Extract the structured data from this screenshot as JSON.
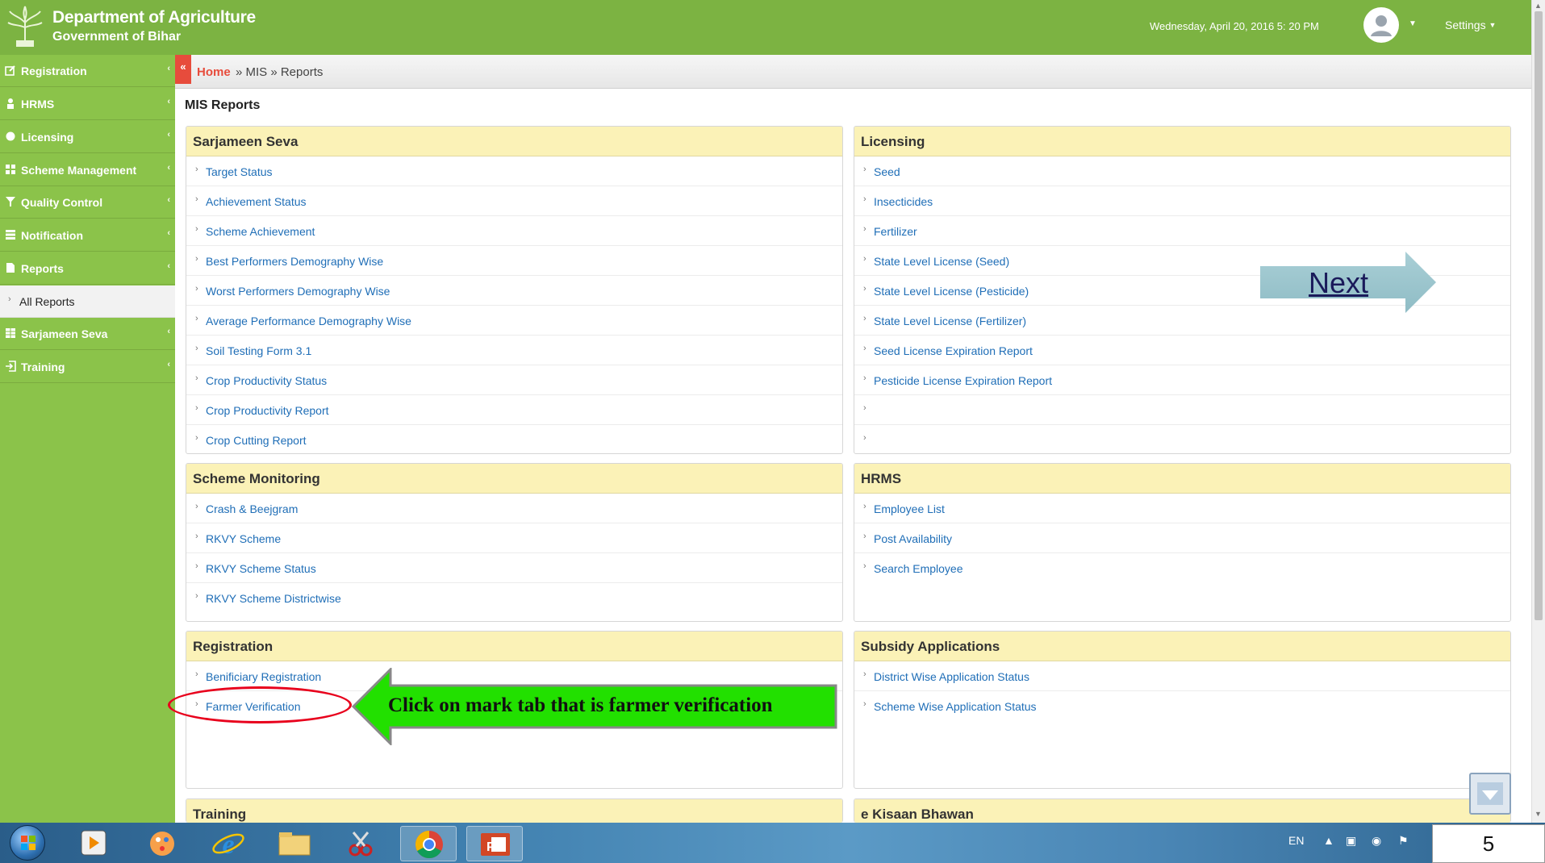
{
  "header": {
    "title": "Department of Agriculture",
    "subtitle": "Government of Bihar",
    "datetime": "Wednesday, April 20, 2016  5: 20 PM",
    "settings_label": "Settings"
  },
  "sidebar": {
    "items": [
      {
        "label": "Registration",
        "icon": "edit-icon",
        "chevron": "‹"
      },
      {
        "label": "HRMS",
        "icon": "user-icon",
        "chevron": "‹"
      },
      {
        "label": "Licensing",
        "icon": "circle-icon",
        "chevron": "‹"
      },
      {
        "label": "Scheme Management",
        "icon": "grid-icon",
        "chevron": "‹"
      },
      {
        "label": "Quality Control",
        "icon": "filter-icon",
        "chevron": "‹"
      },
      {
        "label": "Notification",
        "icon": "list-icon",
        "chevron": "‹"
      },
      {
        "label": "Reports",
        "icon": "document-icon",
        "chevron": "‹"
      },
      {
        "label": "Sarjameen Seva",
        "icon": "table-icon",
        "chevron": "‹"
      },
      {
        "label": "Training",
        "icon": "signin-icon",
        "chevron": "‹"
      }
    ],
    "sub_item": "All Reports"
  },
  "breadcrumb": {
    "toggle": "«",
    "home": "Home",
    "rest": "» MIS » Reports"
  },
  "page_title": "MIS Reports",
  "panels": {
    "sarjameen": {
      "title": "Sarjameen Seva",
      "rows": [
        "Target Status",
        "Achievement Status",
        "Scheme Achievement",
        "Best Performers Demography Wise",
        "Worst Performers Demography Wise",
        "Average Performance Demography Wise",
        "Soil Testing Form 3.1",
        "Crop Productivity Status",
        "Crop Productivity Report",
        "Crop Cutting Report"
      ]
    },
    "licensing": {
      "title": "Licensing",
      "rows": [
        "Seed",
        "Insecticides",
        "Fertilizer",
        "State Level License (Seed)",
        "State Level License (Pesticide)",
        "State Level License (Fertilizer)",
        "Seed License Expiration Report",
        "Pesticide License Expiration Report",
        "",
        ""
      ]
    },
    "scheme_monitoring": {
      "title": "Scheme Monitoring",
      "rows": [
        "Crash & Beejgram",
        "RKVY Scheme",
        "RKVY Scheme Status",
        "RKVY Scheme Districtwise"
      ]
    },
    "hrms": {
      "title": "HRMS",
      "rows": [
        "Employee List",
        "Post Availability",
        "Search Employee"
      ]
    },
    "registration": {
      "title": "Registration",
      "rows": [
        "Benificiary Registration",
        "Farmer Verification"
      ]
    },
    "subsidy": {
      "title": "Subsidy Applications",
      "rows": [
        "District Wise Application Status",
        "Scheme Wise Application Status"
      ]
    },
    "training": {
      "title": "Training"
    },
    "kisaan": {
      "title": "e Kisaan Bhawan"
    }
  },
  "row_arrow": "›",
  "overlays": {
    "next_label": "Next",
    "callout_text": "Click on mark tab that is farmer verification"
  },
  "taskbar": {
    "lang": "EN",
    "slide_number": "5"
  },
  "colors": {
    "header_green": "#7cb342",
    "sidebar_green": "#8bc34a",
    "panel_header": "#fbf2b7",
    "link_blue": "#1f6eb7",
    "callout_green": "#22e000",
    "oval_red": "#e8001c"
  }
}
